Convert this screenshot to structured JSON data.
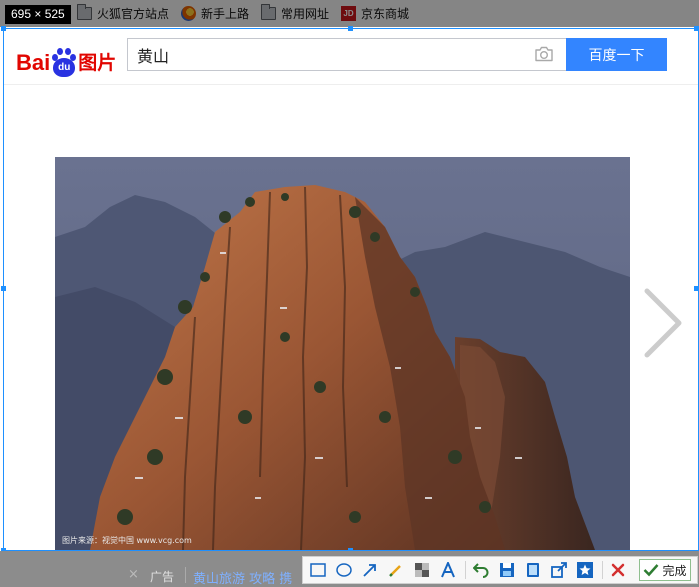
{
  "screenshot_size_label": "695 × 525",
  "bookmarks": [
    {
      "label": "火狐官方站点",
      "icon": "folder-icon"
    },
    {
      "label": "新手上路",
      "icon": "firefox-icon"
    },
    {
      "label": "常用网址",
      "icon": "folder-icon"
    },
    {
      "label": "京东商城",
      "icon": "jd-icon",
      "icon_text": "JD"
    }
  ],
  "baidu": {
    "logo_bai": "Bai",
    "logo_du": "du",
    "logo_pic": "图片",
    "search_value": "黄山",
    "search_button": "百度一下"
  },
  "image": {
    "credit": "图片来源：视觉中国 www.vcg.com"
  },
  "ad": {
    "close": "×",
    "label": "广告",
    "link": "黄山旅游 攻略 携"
  },
  "toolbar": {
    "tools": [
      "rectangle-tool-icon",
      "ellipse-tool-icon",
      "arrow-tool-icon",
      "brush-tool-icon",
      "mosaic-tool-icon",
      "text-tool-icon",
      "undo-icon",
      "save-icon",
      "copy-icon",
      "share-icon",
      "pin-icon",
      "cancel-icon"
    ],
    "done_label": "完成"
  },
  "colors": {
    "selection": "#1e90ff",
    "baidu_red": "#e10601",
    "baidu_blue": "#2932e1",
    "search_button": "#3385ff"
  }
}
